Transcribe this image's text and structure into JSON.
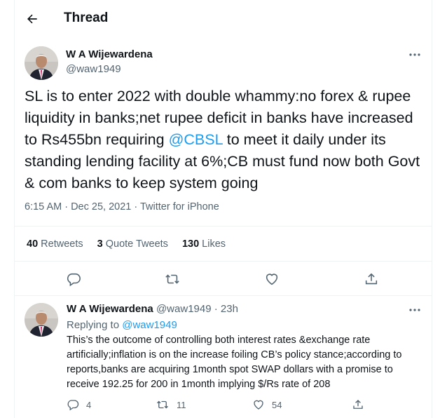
{
  "header": {
    "title": "Thread"
  },
  "tweet": {
    "author_name": "W A Wijewardena",
    "handle": "@waw1949",
    "text_before": "SL is to enter 2022 with double whammy:no forex & rupee liquidity in banks;net rupee deficit in banks have increased to Rs455bn requiring ",
    "mention": "@CBSL",
    "text_after": " to meet it daily under its standing lending facility at 6%;CB must fund now both Govt & com banks to keep system going",
    "timestamp": "6:15 AM · Dec 25, 2021 · Twitter for iPhone",
    "stats": {
      "retweets_count": "40",
      "retweets_label": "Retweets",
      "quotes_count": "3",
      "quotes_label": "Quote Tweets",
      "likes_count": "130",
      "likes_label": "Likes"
    }
  },
  "reply": {
    "author_name": "W A Wijewardena",
    "handle_time": "@waw1949 · 23h",
    "replying_label": "Replying to",
    "replying_handle": "@waw1949",
    "text": "This’s the outcome of controlling both interest rates &exchange rate artificially;inflation is on the increase foiling CB’s policy stance;according to reports,banks are acquiring 1month spot SWAP dollars with a promise to receive 192.25 for 200 in 1month implying $/Rs rate of 208",
    "reply_count": "4",
    "retweet_count": "11",
    "like_count": "54"
  },
  "colors": {
    "accent": "#1d9bf0",
    "text": "#0f1419",
    "muted": "#536471",
    "border": "#eff3f4"
  },
  "icons": [
    "back-arrow-icon",
    "more-icon",
    "reply-icon",
    "retweet-icon",
    "like-icon",
    "share-icon"
  ]
}
